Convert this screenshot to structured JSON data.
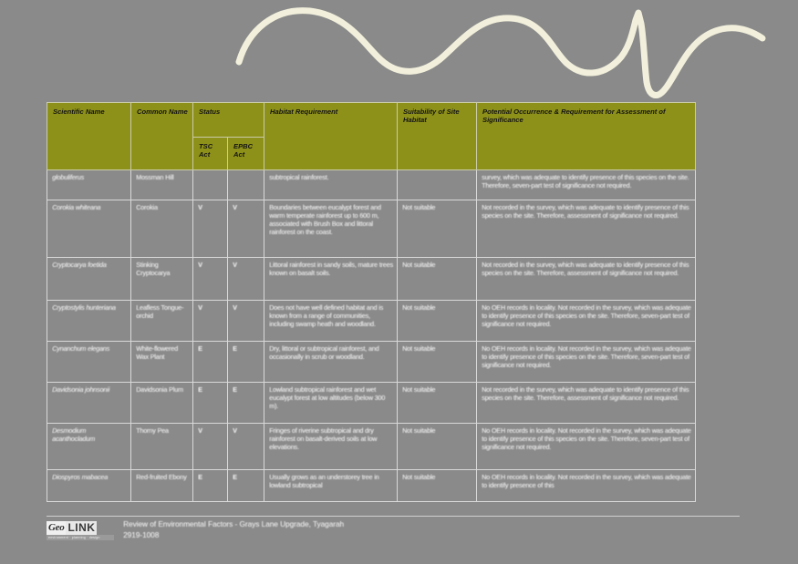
{
  "page": {
    "background_color": "#8a8a8a",
    "swoosh_color": "#f2f0dc"
  },
  "table": {
    "header": {
      "scientific_name": "Scientific Name",
      "common_name": "Common Name",
      "status": "Status",
      "tsc_act": "TSC Act",
      "epbc_act": "EPBC Act",
      "habitat_requirement": "Habitat Requirement",
      "suitability": "Suitability of Site Habitat",
      "occurrence": "Potential Occurrence & Requirement for Assessment of Significance",
      "header_fill": "#8e9119",
      "header_text_color": "#141414"
    },
    "rows": [
      {
        "scientific_name": "globuliferus",
        "common_name": "Mossman Hill",
        "tsc_act": "",
        "epbc_act": "",
        "habitat": "subtropical rainforest.",
        "suitability": "",
        "occurrence": "survey, which was adequate to identify presence of this species on the site.  Therefore, seven-part test of significance not required."
      },
      {
        "scientific_name": "Corokia whiteana",
        "common_name": "Corokia",
        "tsc_act": "V",
        "epbc_act": "V",
        "habitat": "Boundaries between eucalypt forest and warm temperate rainforest up to 600 m, associated with Brush Box and littoral rainforest on the coast.",
        "suitability": "Not suitable",
        "occurrence": "Not recorded in the survey, which was adequate to identify presence of this species on the site. Therefore, assessment of significance not required."
      },
      {
        "scientific_name": "Cryptocarya foetida",
        "common_name": "Stinking Cryptocarya",
        "tsc_act": "V",
        "epbc_act": "V",
        "habitat": "Littoral rainforest in sandy soils, mature trees known on basalt soils.",
        "suitability": "Not suitable",
        "occurrence": "Not recorded in the survey, which was adequate to identify presence of this species on the site. Therefore, assessment of significance not required."
      },
      {
        "scientific_name": "Cryptostylis hunteriana",
        "common_name": "Leafless Tongue-orchid",
        "tsc_act": "V",
        "epbc_act": "V",
        "habitat": "Does not have well defined habitat and is known from a range of communities, including swamp heath and woodland.",
        "suitability": "Not suitable",
        "occurrence": "No OEH records in locality. Not recorded in the survey, which was adequate to identify presence of this species on the site.  Therefore, seven-part test of significance not required."
      },
      {
        "scientific_name": "Cynanchum elegans",
        "common_name": "White-flowered Wax Plant",
        "tsc_act": "E",
        "epbc_act": "E",
        "habitat": "Dry, littoral or subtropical rainforest, and occasionally in scrub or woodland.",
        "suitability": "Not suitable",
        "occurrence": "No OEH records in locality. Not recorded in the survey, which was adequate to identify presence of this species on the site.  Therefore, seven-part test of significance not required."
      },
      {
        "scientific_name": "Davidsonia johnsonii",
        "common_name": "Davidsonia Plum",
        "tsc_act": "E",
        "epbc_act": "E",
        "habitat": "Lowland subtropical rainforest and wet eucalypt forest at low altitudes (below 300 m).",
        "suitability": "Not suitable",
        "occurrence": "Not recorded in the survey, which was adequate to identify presence of this species on the site. Therefore, assessment of significance not required."
      },
      {
        "scientific_name": "Desmodium acanthocladum",
        "common_name": "Thorny Pea",
        "tsc_act": "V",
        "epbc_act": "V",
        "habitat": "Fringes of riverine subtropical and dry rainforest on basalt-derived soils at low elevations.",
        "suitability": "Not suitable",
        "occurrence": "No OEH records in locality. Not recorded in the survey, which was adequate to identify presence of this species on the site.  Therefore, seven-part test of significance not required."
      },
      {
        "scientific_name": "Diospyros mabacea",
        "common_name": "Red-fruited Ebony",
        "tsc_act": "E",
        "epbc_act": "E",
        "habitat": "Usually grows as an understorey tree in lowland subtropical",
        "suitability": "Not suitable",
        "occurrence": "No OEH records in locality. Not recorded in the survey, which was adequate to identify presence of this"
      }
    ]
  },
  "footer": {
    "logo_geo": "Geo",
    "logo_link": "LINK",
    "logo_sub": "environment · planning · design",
    "line1": "Review of Environmental Factors - Grays Lane Upgrade, Tyagarah",
    "line2": "2919-1008"
  }
}
